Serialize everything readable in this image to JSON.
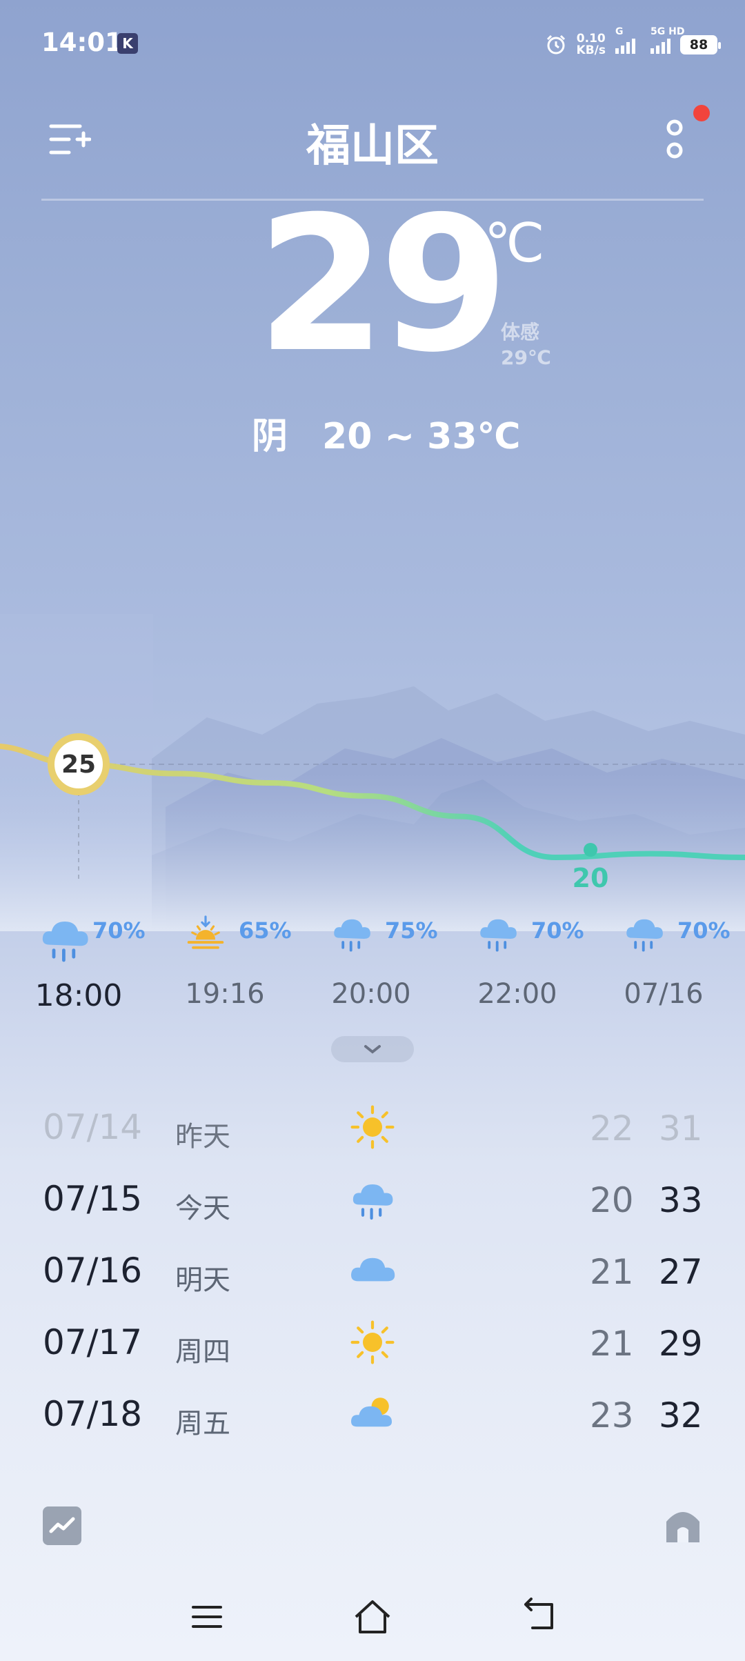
{
  "status_bar": {
    "time": "14:01",
    "app_badge": "K",
    "net_speed_value": "0.10",
    "net_speed_unit": "KB/s",
    "signal1_label": "G",
    "signal2_label": "5G HD",
    "battery": "88"
  },
  "header": {
    "city": "福山区"
  },
  "current": {
    "temp": "29",
    "unit": "℃",
    "feels_like_label": "体感",
    "feels_like_value": "29℃",
    "condition": "阴",
    "range": "20 ~ 33℃"
  },
  "chart_data": {
    "type": "line",
    "title": "",
    "series": [
      {
        "name": "",
        "values": [
          26,
          25,
          24.5,
          24,
          23.3,
          22.2,
          20,
          20.2,
          20
        ]
      }
    ],
    "labels": [
      {
        "text": "25"
      },
      {
        "text": "20"
      }
    ]
  },
  "hourly": [
    {
      "time": "18:00",
      "pct": "70%",
      "icon": "rain-cloud-icon",
      "now": true
    },
    {
      "time": "19:16",
      "pct": "65%",
      "icon": "sunset-icon",
      "now": false
    },
    {
      "time": "20:00",
      "pct": "75%",
      "icon": "rain-cloud-icon",
      "now": false
    },
    {
      "time": "22:00",
      "pct": "70%",
      "icon": "rain-cloud-icon",
      "now": false
    },
    {
      "time": "07/16",
      "pct": "70%",
      "icon": "rain-cloud-icon",
      "now": false
    }
  ],
  "daily": [
    {
      "date": "07/14",
      "name": "昨天",
      "icon": "sun-icon",
      "low": "22",
      "high": "31",
      "past": true
    },
    {
      "date": "07/15",
      "name": "今天",
      "icon": "rain-cloud-icon",
      "low": "20",
      "high": "33",
      "past": false
    },
    {
      "date": "07/16",
      "name": "明天",
      "icon": "cloud-icon",
      "low": "21",
      "high": "27",
      "past": false
    },
    {
      "date": "07/17",
      "name": "周四",
      "icon": "sun-icon",
      "low": "21",
      "high": "29",
      "past": false
    },
    {
      "date": "07/18",
      "name": "周五",
      "icon": "partly-cloudy-icon",
      "low": "23",
      "high": "32",
      "past": false
    }
  ],
  "colors": {
    "accent_blue": "#5b9bea",
    "curve_warm": "#e8c96a",
    "curve_cool": "#4fd0b8",
    "notification": "#f2443c"
  }
}
